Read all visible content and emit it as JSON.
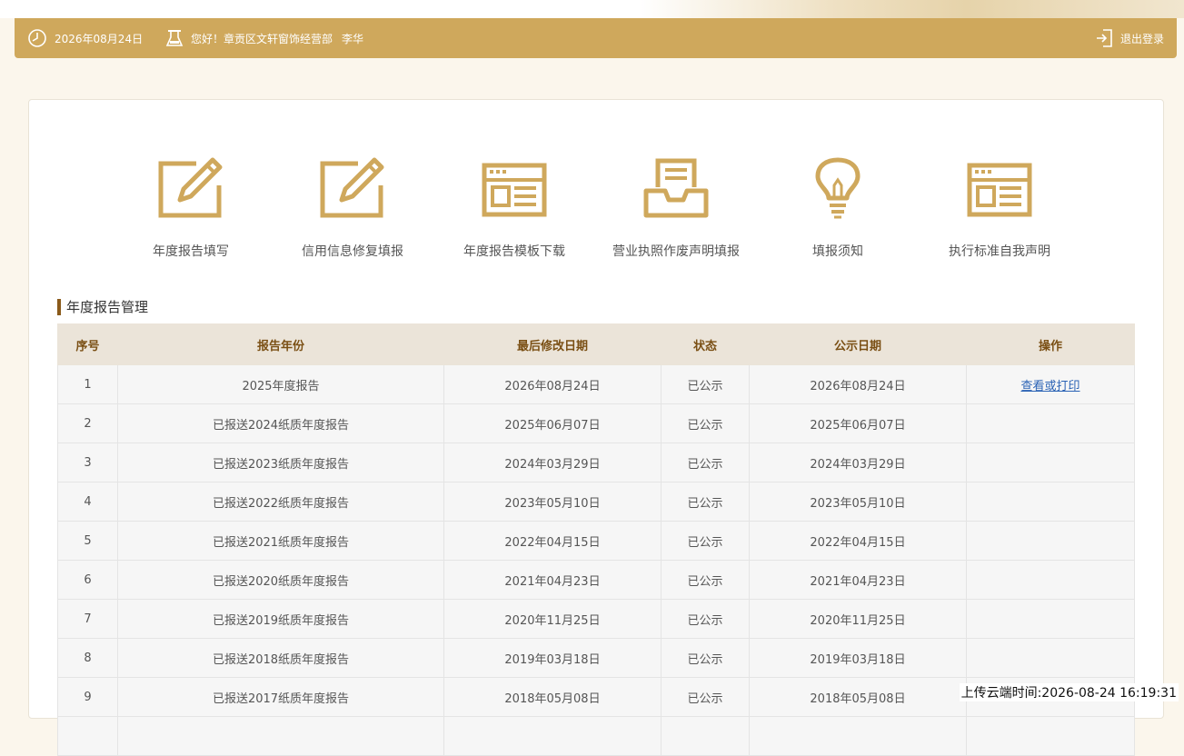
{
  "header": {
    "date": "2026年08月24日",
    "greeting": "您好！章贡区文轩窗饰经营部",
    "user_name": "李华",
    "logout_label": "退出登录",
    "icons": [
      "clock-icon",
      "user-badge-icon",
      "logout-icon"
    ]
  },
  "features": [
    {
      "label": "年度报告填写",
      "icon": "edit-form-icon"
    },
    {
      "label": "信用信息修复填报",
      "icon": "edit-form-icon"
    },
    {
      "label": "年度报告模板下载",
      "icon": "template-window-icon"
    },
    {
      "label": "营业执照作废声明填报",
      "icon": "inbox-document-icon"
    },
    {
      "label": "填报须知",
      "icon": "lightbulb-icon"
    },
    {
      "label": "执行标准自我声明",
      "icon": "template-window-icon"
    }
  ],
  "section_title": "年度报告管理",
  "table": {
    "headers": [
      "序号",
      "报告年份",
      "最后修改日期",
      "状态",
      "公示日期",
      "操作"
    ],
    "rows": [
      [
        "1",
        "2025年度报告",
        "2026年08月24日",
        "已公示",
        "2026年08月24日",
        "查看或打印"
      ],
      [
        "2",
        "已报送2024纸质年度报告",
        "2025年06月07日",
        "已公示",
        "2025年06月07日",
        ""
      ],
      [
        "3",
        "已报送2023纸质年度报告",
        "2024年03月29日",
        "已公示",
        "2024年03月29日",
        ""
      ],
      [
        "4",
        "已报送2022纸质年度报告",
        "2023年05月10日",
        "已公示",
        "2023年05月10日",
        ""
      ],
      [
        "5",
        "已报送2021纸质年度报告",
        "2022年04月15日",
        "已公示",
        "2022年04月15日",
        ""
      ],
      [
        "6",
        "已报送2020纸质年度报告",
        "2021年04月23日",
        "已公示",
        "2021年04月23日",
        ""
      ],
      [
        "7",
        "已报送2019纸质年度报告",
        "2020年11月25日",
        "已公示",
        "2020年11月25日",
        ""
      ],
      [
        "8",
        "已报送2018纸质年度报告",
        "2019年03月18日",
        "已公示",
        "2019年03月18日",
        ""
      ],
      [
        "9",
        "已报送2017纸质年度报告",
        "2018年05月08日",
        "已公示",
        "2018年05月08日",
        ""
      ]
    ]
  },
  "upload_time": "上传云端时间:2026-08-24 16:19:31",
  "colors": {
    "accent": "#cfa85c",
    "header_text": "#7a4f14",
    "link": "#2b63b5"
  }
}
